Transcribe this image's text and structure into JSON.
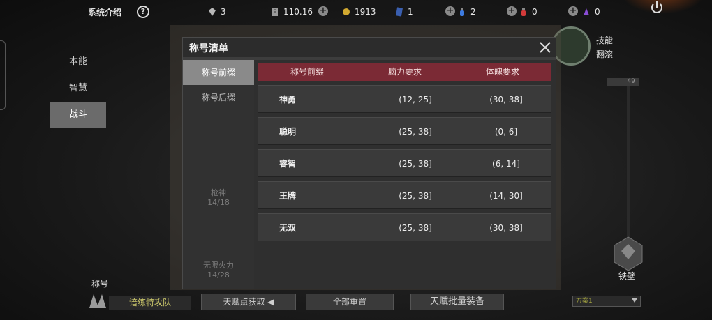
{
  "topbar": {
    "title": "系统介绍",
    "help_label": "?",
    "resources": [
      {
        "icon": "gem-icon",
        "value": "3"
      },
      {
        "icon": "scroll-icon",
        "value": "110.16"
      },
      {
        "icon": "gold-coin-icon",
        "value": "1913"
      },
      {
        "icon": "card-icon",
        "value": "1"
      },
      {
        "icon": "blue-potion-icon",
        "value": "2"
      },
      {
        "icon": "red-potion-icon",
        "value": "0"
      },
      {
        "icon": "purple-potion-icon",
        "value": "0"
      }
    ]
  },
  "left_nav": [
    "本能",
    "智慧",
    "战斗"
  ],
  "bg_skill": {
    "label1": "技能",
    "label2": "翻滚",
    "bar_value": "49"
  },
  "bg_tiebi": "铁壁",
  "modal": {
    "title": "称号清单",
    "tabs": [
      "称号前缀",
      "称号后缀"
    ],
    "ghost_items": [
      {
        "name": "枪神",
        "count": "14/18"
      },
      {
        "name": "无限火力",
        "count": "14/28"
      }
    ],
    "table": {
      "headers": [
        "称号前缀",
        "脑力要求",
        "体魄要求"
      ],
      "rows": [
        [
          "神勇",
          "(12, 25]",
          "(30, 38]"
        ],
        [
          "聪明",
          "(25, 38]",
          "(0, 6]"
        ],
        [
          "睿智",
          "(25, 38]",
          "(6, 14]"
        ],
        [
          "王牌",
          "(25, 38]",
          "(14, 30]"
        ],
        [
          "无双",
          "(25, 38]",
          "(30, 38]"
        ]
      ]
    }
  },
  "bottom": {
    "section_title": "称号",
    "team_name": "谙练特攻队",
    "talent_get": "天赋点获取",
    "reset_all": "全部重置",
    "batch_equip": "天赋批量装备",
    "plan_select": "方案1"
  }
}
